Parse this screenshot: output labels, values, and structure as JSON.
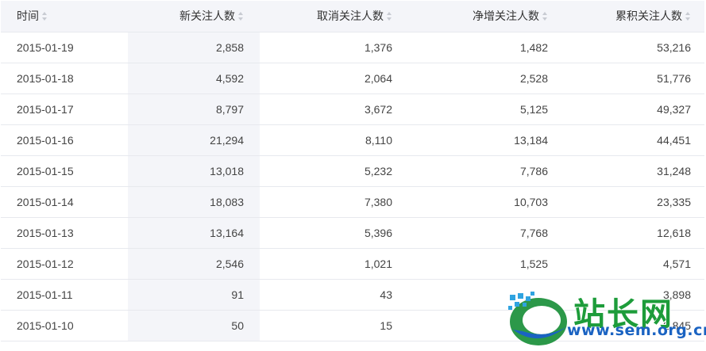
{
  "table": {
    "headers": [
      "时间",
      "新关注人数",
      "取消关注人数",
      "净增关注人数",
      "累积关注人数"
    ],
    "rows": [
      [
        "2015-01-19",
        "2,858",
        "1,376",
        "1,482",
        "53,216"
      ],
      [
        "2015-01-18",
        "4,592",
        "2,064",
        "2,528",
        "51,776"
      ],
      [
        "2015-01-17",
        "8,797",
        "3,672",
        "5,125",
        "49,327"
      ],
      [
        "2015-01-16",
        "21,294",
        "8,110",
        "13,184",
        "44,451"
      ],
      [
        "2015-01-15",
        "13,018",
        "5,232",
        "7,786",
        "31,248"
      ],
      [
        "2015-01-14",
        "18,083",
        "7,380",
        "10,703",
        "23,335"
      ],
      [
        "2015-01-13",
        "13,164",
        "5,396",
        "7,768",
        "12,618"
      ],
      [
        "2015-01-12",
        "2,546",
        "1,021",
        "1,525",
        "4,571"
      ],
      [
        "2015-01-11",
        "91",
        "43",
        "",
        "3,898"
      ],
      [
        "2015-01-10",
        "50",
        "15",
        "",
        "2,845"
      ]
    ]
  },
  "watermark": {
    "cn_text": "站长网",
    "url_text": "www.sem.org.cn"
  },
  "colors": {
    "header_bg": "#f4f5f9",
    "border": "#e7e9ee",
    "highlight_col": "#f4f5f9",
    "watermark_green": "#1d9c3a",
    "watermark_blue": "#1a63c2"
  }
}
